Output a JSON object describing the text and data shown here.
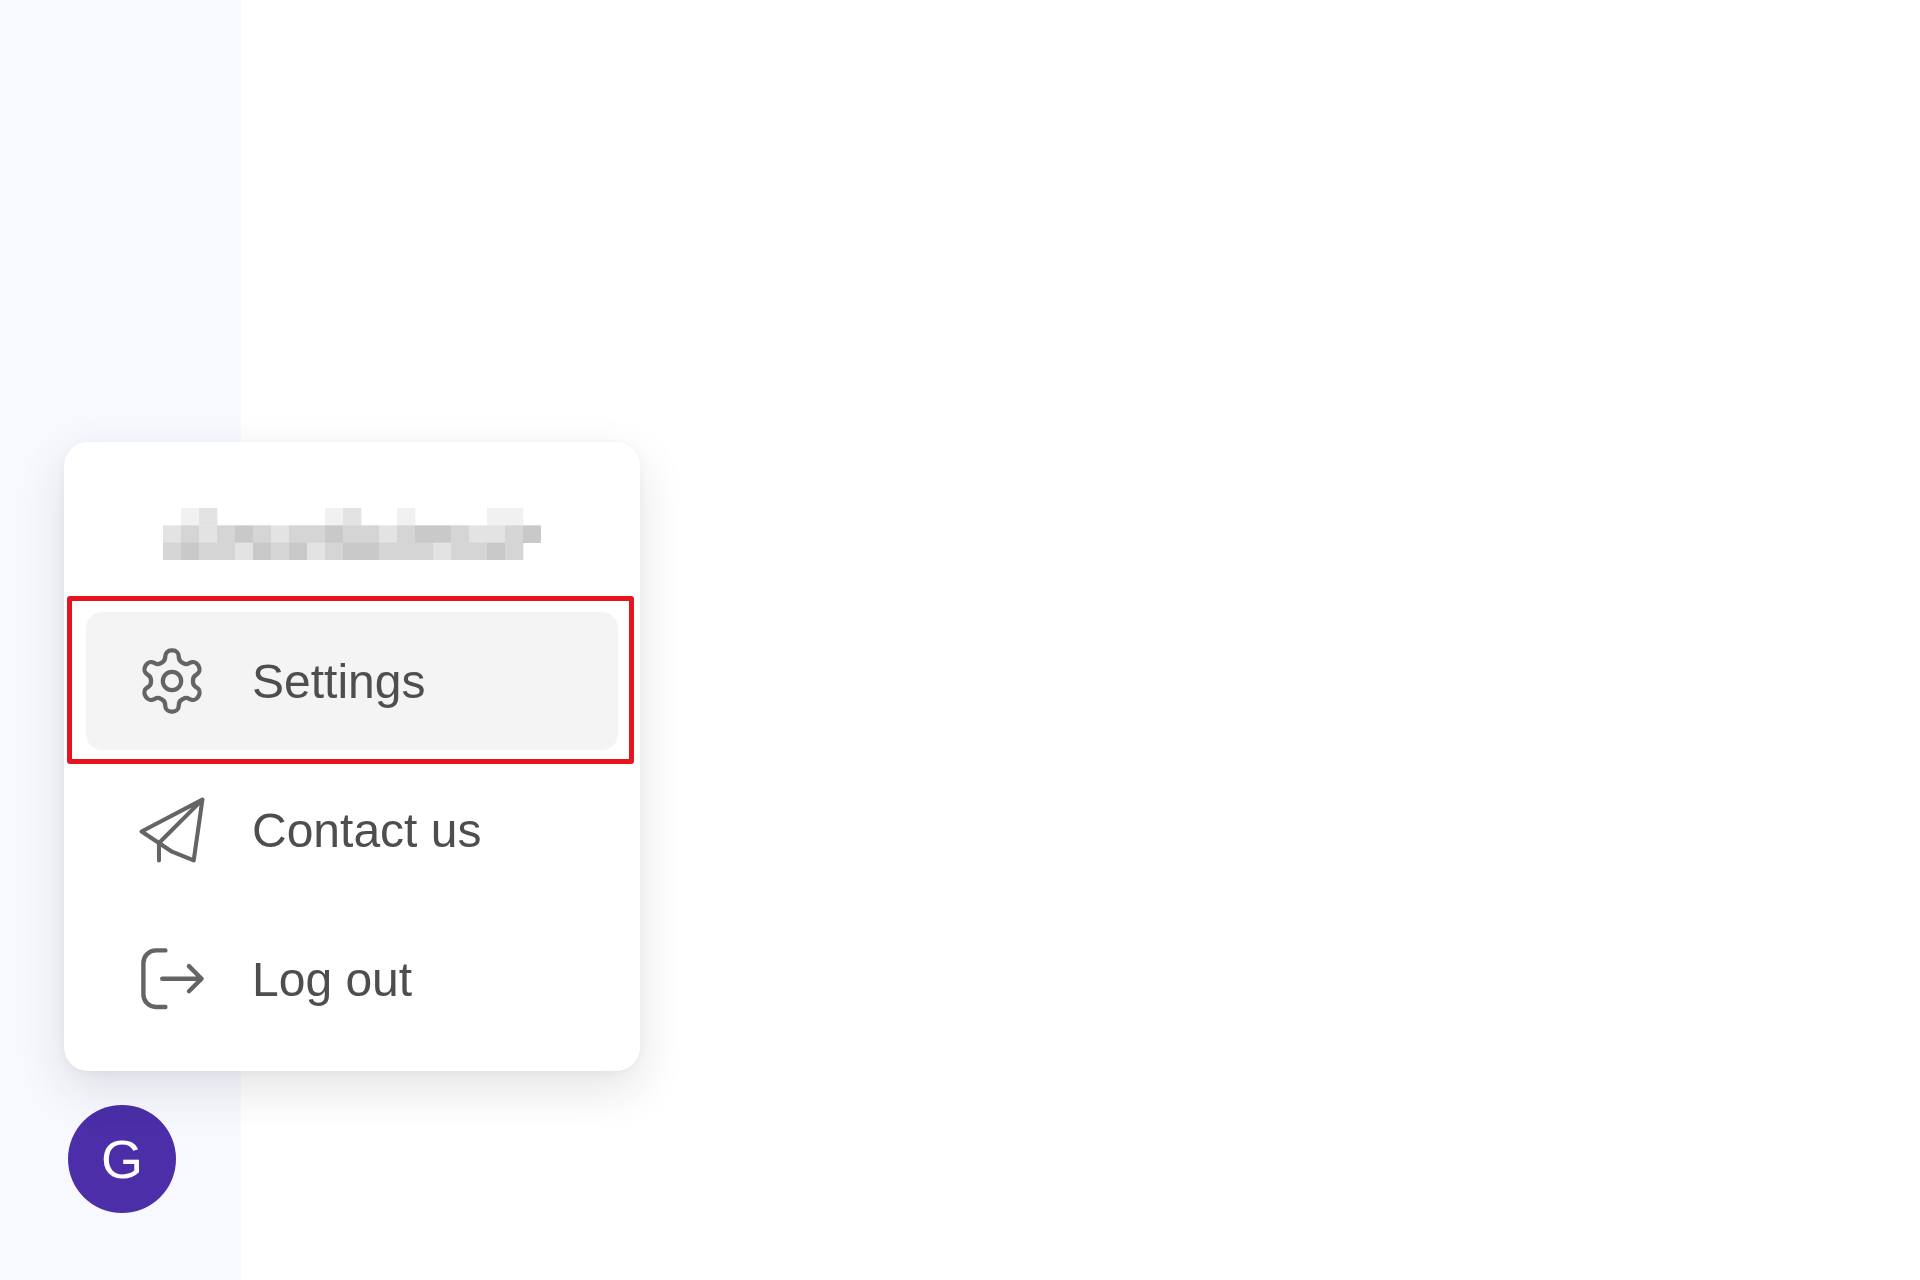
{
  "sidebar": {
    "avatar": {
      "initial": "G"
    }
  },
  "account_menu": {
    "header": {
      "redacted": true
    },
    "items": [
      {
        "label": "Settings",
        "selected": true,
        "outlined": true
      },
      {
        "label": "Contact us",
        "selected": false,
        "outlined": false
      },
      {
        "label": "Log out",
        "selected": false,
        "outlined": false
      }
    ]
  }
}
